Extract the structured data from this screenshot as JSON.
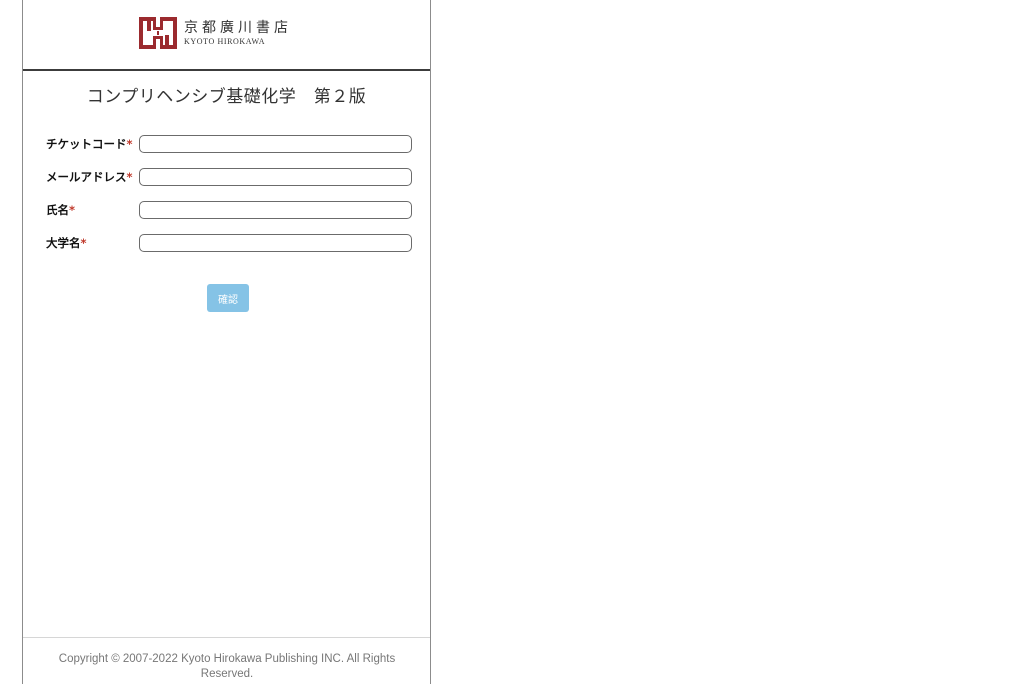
{
  "header": {
    "logo_jp": "京都廣川書店",
    "logo_en": "KYOTO HIROKAWA",
    "brand_color": "#9b2a2e"
  },
  "title": "コンプリヘンシブ基礎化学　第２版",
  "form": {
    "required_mark": "*",
    "fields": [
      {
        "label": "チケットコード",
        "value": "",
        "placeholder": ""
      },
      {
        "label": "メールアドレス",
        "value": "",
        "placeholder": ""
      },
      {
        "label": "氏名",
        "value": "",
        "placeholder": ""
      },
      {
        "label": "大学名",
        "value": "",
        "placeholder": ""
      }
    ],
    "confirm_label": "確認",
    "confirm_color": "#85c3e6"
  },
  "footer": {
    "copyright": "Copyright © 2007-2022 Kyoto Hirokawa Publishing INC. All Rights Reserved."
  }
}
